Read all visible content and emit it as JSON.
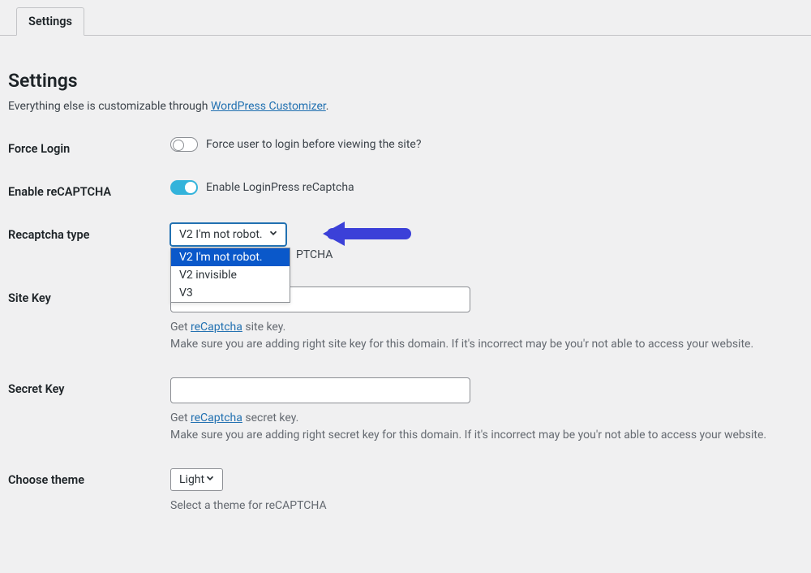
{
  "tab": {
    "label": "Settings"
  },
  "header": {
    "title": "Settings",
    "subtitle_prefix": "Everything else is customizable through ",
    "subtitle_link": "WordPress Customizer",
    "subtitle_suffix": "."
  },
  "force_login": {
    "label": "Force Login",
    "description": "Force user to login before viewing the site?"
  },
  "enable_recaptcha": {
    "label": "Enable reCAPTCHA",
    "description": "Enable LoginPress reCaptcha"
  },
  "recaptcha_type": {
    "label": "Recaptcha type",
    "selected": "V2 I'm not robot.",
    "options": [
      "V2 I'm not robot.",
      "V2 invisible",
      "V3"
    ],
    "behind_text": "PTCHA"
  },
  "site_key": {
    "label": "Site Key",
    "help_prefix": "Get ",
    "help_link": "reCaptcha",
    "help_suffix": " site key.",
    "warning": "Make sure you are adding right site key for this domain. If it's incorrect may be you'r not able to access your website."
  },
  "secret_key": {
    "label": "Secret Key",
    "help_prefix": "Get ",
    "help_link": "reCaptcha",
    "help_suffix": " secret key.",
    "warning": "Make sure you are adding right secret key for this domain. If it's incorrect may be you'r not able to access your website."
  },
  "theme": {
    "label": "Choose theme",
    "selected": "Light",
    "help": "Select a theme for reCAPTCHA"
  }
}
